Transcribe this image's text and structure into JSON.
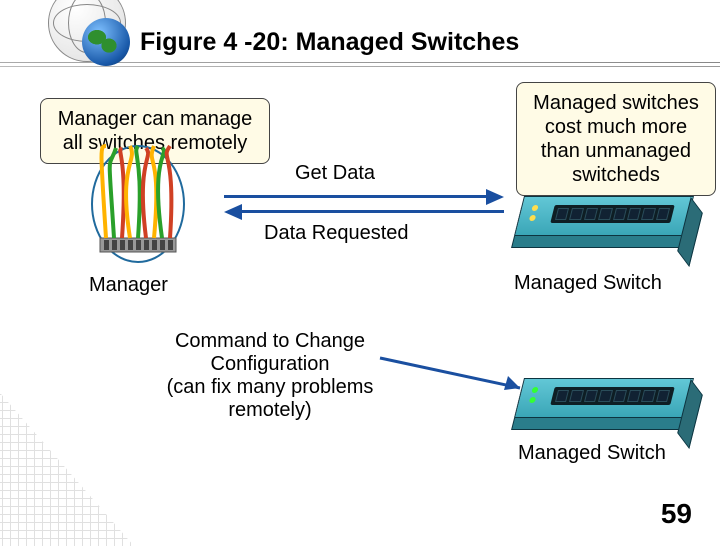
{
  "figure_caption": "Figure 4 -20: Managed Switches",
  "callouts": {
    "manager_remote": "Manager can manage all switches remotely",
    "cost": "Managed switches cost much more than unmanaged switcheds"
  },
  "labels": {
    "get_data": "Get Data",
    "data_requested": "Data Requested",
    "manager": "Manager",
    "managed_switch_1": "Managed Switch",
    "managed_switch_2": "Managed Switch",
    "command": "Command to Change Configuration\n(can fix many problems remotely)"
  },
  "page_number": "59"
}
